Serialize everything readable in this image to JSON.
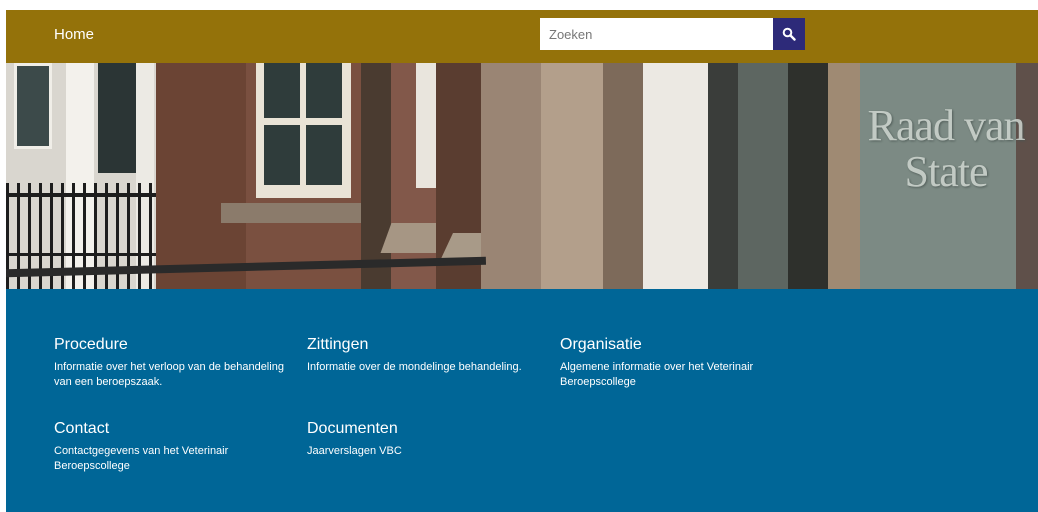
{
  "header": {
    "home_label": "Home",
    "search_placeholder": "Zoeken",
    "search_icon": "search-icon",
    "bar_color": "#94720a",
    "search_button_color": "#2d2a79"
  },
  "hero": {
    "caption": "Raad van State"
  },
  "panel": {
    "background": "#006697",
    "cards": [
      {
        "title": "Procedure",
        "text": "Informatie over het verloop van de behandeling van een beroepszaak."
      },
      {
        "title": "Zittingen",
        "text": "Informatie over de mondelinge behandeling."
      },
      {
        "title": "Organisatie",
        "text": "Algemene informatie over het Veterinair Beroepscollege"
      },
      {
        "title": "Contact",
        "text": "Contactgegevens van het Veterinair Beroepscollege"
      },
      {
        "title": "Documenten",
        "text": "Jaarverslagen VBC"
      }
    ]
  }
}
